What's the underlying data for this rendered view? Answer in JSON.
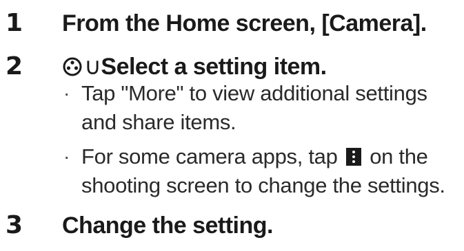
{
  "steps": [
    {
      "number": "1",
      "text": "From the Home screen, [Camera]."
    },
    {
      "number": "2",
      "arrow": "∪",
      "text": "Select a setting item."
    },
    {
      "number": "3",
      "text": "Change the setting."
    }
  ],
  "bullets": [
    {
      "text": "Tap \"More\" to view additional settings and share items."
    },
    {
      "before_icon": "For some camera apps, tap",
      "after_icon": "on the shooting screen to change the settings."
    }
  ],
  "icons": {
    "step2_icon": "settings-gear-icon",
    "inline_icon": "more-options-icon"
  }
}
